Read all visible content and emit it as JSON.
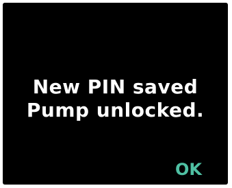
{
  "message": {
    "line1": "New PIN saved",
    "line2": "Pump unlocked."
  },
  "softkey": {
    "ok_label": "OK"
  },
  "colors": {
    "screen_background": "#000000",
    "text": "#ffffff",
    "accent": "#4fc0a3"
  }
}
